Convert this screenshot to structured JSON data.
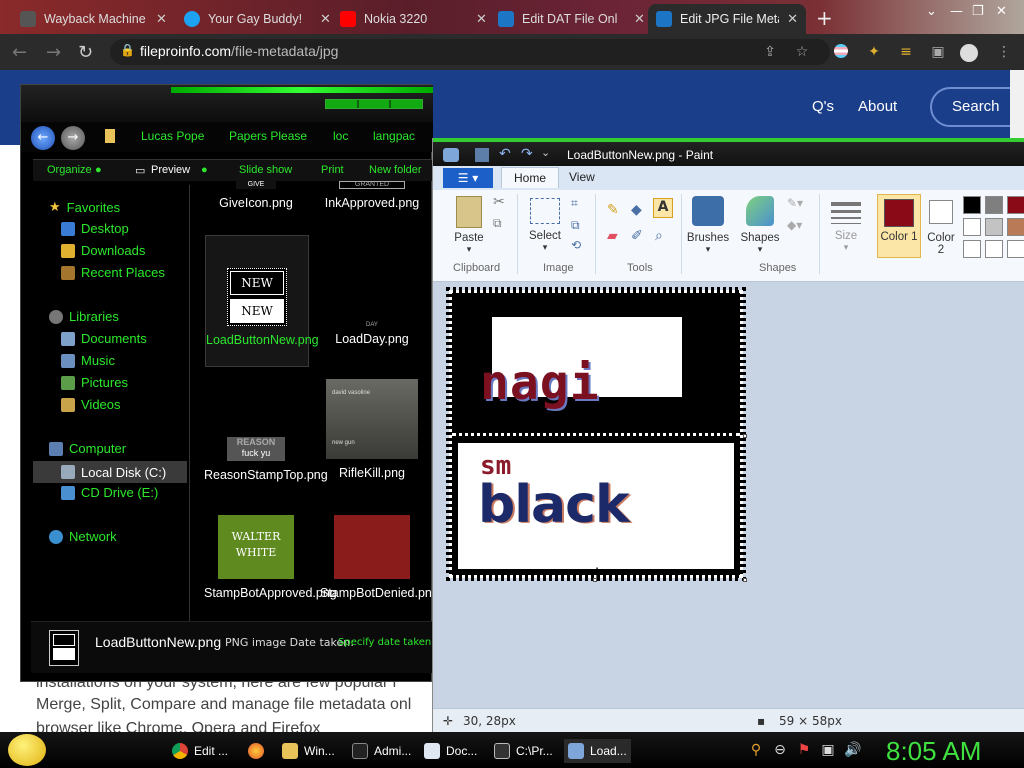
{
  "browser": {
    "tabs": [
      {
        "title": "Wayback Machine",
        "color": "#333333"
      },
      {
        "title": "Your Gay Buddy!",
        "color": "#1da1f2"
      },
      {
        "title": "Nokia 3220",
        "color": "#ff0000"
      },
      {
        "title": "Edit DAT File Onl",
        "color": "#1d76c5"
      },
      {
        "title": "Edit JPG File Meta",
        "color": "#1d76c5"
      }
    ],
    "url_domain": "fileproinfo.com",
    "url_path": "/file-metadata/jpg"
  },
  "website": {
    "nav_partial": "Q's",
    "about": "About",
    "search": "Search",
    "text_line1": "installations on your system, here are few popular i",
    "text_line2": "Merge, Split, Compare and manage file metadata onl",
    "text_line3": "browser like Chrome, Opera and Firefox"
  },
  "explorer": {
    "breadcrumbs": [
      "Lucas Pope",
      "Papers Please",
      "loc",
      "langpac"
    ],
    "commands": [
      "Organize",
      "Preview",
      "Slide show",
      "Print",
      "New folder"
    ],
    "nav": {
      "favorites": "Favorites",
      "fav_items": [
        "Desktop",
        "Downloads",
        "Recent Places"
      ],
      "libraries": "Libraries",
      "lib_items": [
        "Documents",
        "Music",
        "Pictures",
        "Videos"
      ],
      "computer": "Computer",
      "comp_items": [
        "Local Disk (C:)",
        "CD Drive (E:)"
      ],
      "network": "Network"
    },
    "files": [
      {
        "name": "GiveIcon.png",
        "thumb_text": "GIVE"
      },
      {
        "name": "InkApproved.png",
        "thumb_text": "GRANTED"
      },
      {
        "name": "LoadButtonNew.png",
        "thumb_text": "NEW"
      },
      {
        "name": "LoadDay.png",
        "thumb_text": "DAY"
      },
      {
        "name": "ReasonStampTop.png",
        "thumb_text": "REASON",
        "thumb_text2": "fuck yu"
      },
      {
        "name": "RifleKill.png",
        "thumb_text": "david vasoline",
        "thumb_text2": "new gun"
      },
      {
        "name": "StampBotApproved.png",
        "thumb_text": "WALTER WHITE"
      },
      {
        "name": "StampBotDenied.png",
        "thumb_text": ""
      }
    ],
    "details": {
      "filename": "LoadButtonNew.png",
      "type": "PNG image",
      "date_label": "Date taken:",
      "date_value": "Specify date taken"
    }
  },
  "paint": {
    "title": "LoadButtonNew.png - Paint",
    "file_btn": "▾",
    "tabs": [
      "Home",
      "View"
    ],
    "ribbon": {
      "paste": "Paste",
      "clipboard": "Clipboard",
      "select": "Select",
      "image": "Image",
      "tools": "Tools",
      "brushes": "Brushes",
      "shapes": "Shapes",
      "shapes_group": "Shapes",
      "size": "Size",
      "color1": "Color 1",
      "color2": "Color 2",
      "color1_value": "#8b0a17",
      "color2_value": "#ffffff"
    },
    "canvas_text_top": "nagi",
    "canvas_text_bottom_small": "sm",
    "canvas_text_bottom": "black",
    "status_pos": "30, 28px",
    "status_size": "59 × 58px"
  },
  "taskbar": {
    "items": [
      "Edit ...",
      "Win...",
      "Admi...",
      "Doc...",
      "C:\\Pr...",
      "Load..."
    ],
    "clock": "8:05 AM"
  }
}
